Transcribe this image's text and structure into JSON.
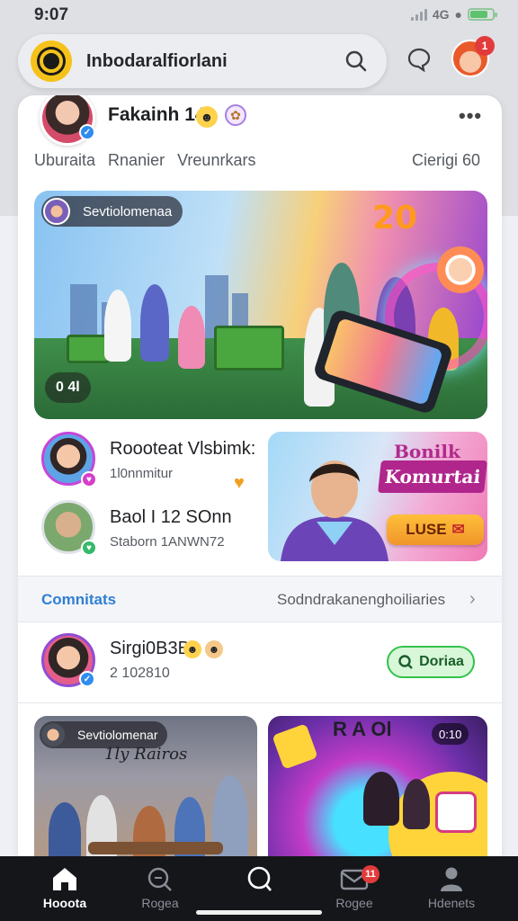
{
  "status_bar": {
    "time": "9:07",
    "network": "4G"
  },
  "search": {
    "title": "Inbodaralfiorlani"
  },
  "top_bar": {
    "notification_count": "1"
  },
  "header": {
    "name": "Fakainh 14",
    "tabs": [
      "Uburaita",
      "Rnanier",
      "Vreunrkars"
    ],
    "right_tab": "Cierigi 60"
  },
  "hero": {
    "tag": "Sevtiolomenaa",
    "counter": "0 4l",
    "badge": "20"
  },
  "rows": [
    {
      "title": "Roooteat Vlsbimk:",
      "subtitle": "1l0nnmitur"
    },
    {
      "title": "Baol I 12 SOnn",
      "subtitle": "Staborn  1ANWN72"
    }
  ],
  "promo": {
    "label": "Bonilk",
    "banner": "Komurtai",
    "button": "LUSE"
  },
  "section": {
    "left": "Comnitats",
    "right": "Sodndrakanenghoiliaries"
  },
  "user": {
    "name": "Sirgi0B3B",
    "id": "2 102810",
    "follow": "Doriaa"
  },
  "cards": {
    "left_tag": "Sevtiolomenar",
    "left_sub": "1ly Rairos",
    "right_title": "R A Ol",
    "right_count": "0:10"
  },
  "bottom_nav": {
    "items": [
      {
        "label": "Hooota",
        "icon": "home-icon",
        "active": true
      },
      {
        "label": "Rogea",
        "icon": "search-icon",
        "active": false
      },
      {
        "label": "",
        "icon": "discover-icon",
        "active": false
      },
      {
        "label": "Rogee",
        "icon": "mail-icon",
        "active": false,
        "badge": "11"
      },
      {
        "label": "Hdenets",
        "icon": "profile-icon",
        "active": false
      }
    ]
  },
  "colors": {
    "accent_blue": "#2f7fd3",
    "brand_yellow": "#f6c21a",
    "badge_red": "#e23b3b",
    "follow_green": "#33c24b"
  }
}
